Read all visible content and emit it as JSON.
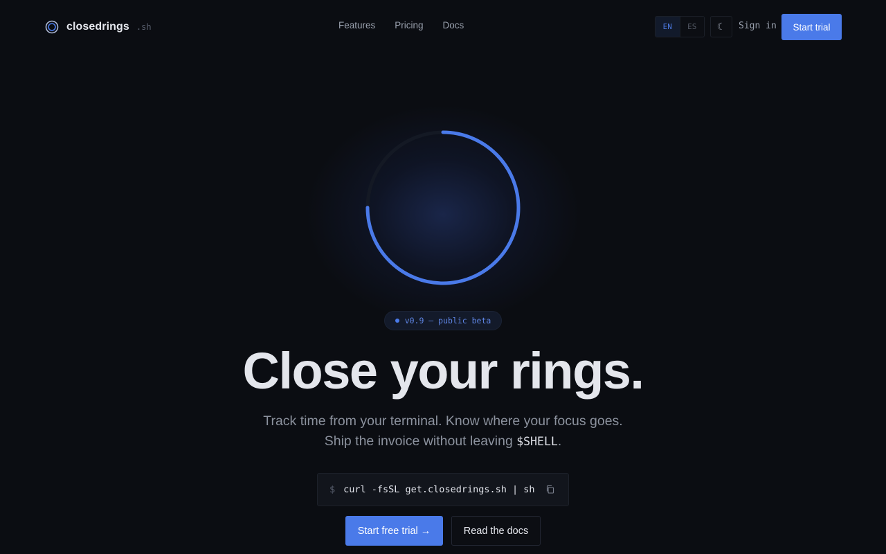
{
  "brand": {
    "name": "closedrings",
    "suffix": ".sh",
    "icon": "ring-logo-icon"
  },
  "nav": {
    "items": [
      {
        "label": "Features"
      },
      {
        "label": "Pricing"
      },
      {
        "label": "Docs"
      }
    ]
  },
  "header": {
    "languages": [
      "EN",
      "ES"
    ],
    "active_language": "EN",
    "theme_icon": "☾",
    "sign_in_label": "Sign in",
    "start_trial_label": "Start trial"
  },
  "hero": {
    "ring_progress": 0.75,
    "badge": "v0.9 — public beta",
    "headline": "Close your rings.",
    "subline_1": "Track time from your terminal. Know where your focus goes.",
    "subline_2_prefix": "Ship the invoice without leaving ",
    "subline_2_code": "$SHELL",
    "subline_2_suffix": ".",
    "install_prompt": "$",
    "install_command": "curl -fsSL get.closedrings.sh | sh",
    "copy_icon": "copy-icon",
    "primary_cta": "Start free trial →",
    "secondary_cta": "Read the docs"
  },
  "colors": {
    "background": "#0b0d12",
    "accent": "#4a7ae9",
    "text": "#e4e6ec",
    "muted": "#8b919d"
  }
}
